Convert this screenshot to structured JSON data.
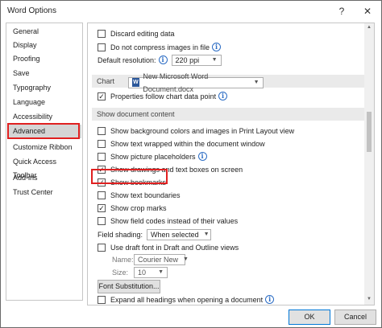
{
  "window": {
    "title": "Word Options",
    "help_glyph": "?",
    "close_glyph": "✕"
  },
  "sidebar": {
    "items": [
      {
        "label": "General"
      },
      {
        "label": "Display"
      },
      {
        "label": "Proofing"
      },
      {
        "label": "Save"
      },
      {
        "label": "Typography"
      },
      {
        "label": "Language"
      },
      {
        "label": "Accessibility"
      },
      {
        "label": "Advanced",
        "selected": true
      },
      {
        "label": "Customize Ribbon"
      },
      {
        "label": "Quick Access Toolbar"
      },
      {
        "label": "Add-ins"
      },
      {
        "label": "Trust Center"
      }
    ]
  },
  "image_size": {
    "discard_editing": "Discard editing data",
    "no_compress": "Do not compress images in file",
    "default_resolution_label": "Default resolution:",
    "default_resolution_value": "220 ppi"
  },
  "chart": {
    "section_label": "Chart",
    "document": "New Microsoft Word Document.docx",
    "properties_follow": "Properties follow chart data point"
  },
  "show_document_content": {
    "section_label": "Show document content",
    "background": "Show background colors and images in Print Layout view",
    "text_wrapped": "Show text wrapped within the document window",
    "picture_placeholders": "Show picture placeholders",
    "drawings": "Show drawings and text boxes on screen",
    "bookmarks": "Show bookmarks",
    "text_boundaries": "Show text boundaries",
    "crop_marks": "Show crop marks",
    "field_codes": "Show field codes instead of their values",
    "field_shading_label": "Field shading:",
    "field_shading_value": "When selected",
    "draft_font": "Use draft font in Draft and Outline views",
    "name_label": "Name:",
    "name_value": "Courier New",
    "size_label": "Size:",
    "size_value": "10",
    "font_substitution": "Font Substitution...",
    "expand_headings": "Expand all headings when opening a document"
  },
  "footer": {
    "ok": "OK",
    "cancel": "Cancel"
  },
  "colors": {
    "highlight": "#e02020",
    "accent": "#0078d7"
  }
}
